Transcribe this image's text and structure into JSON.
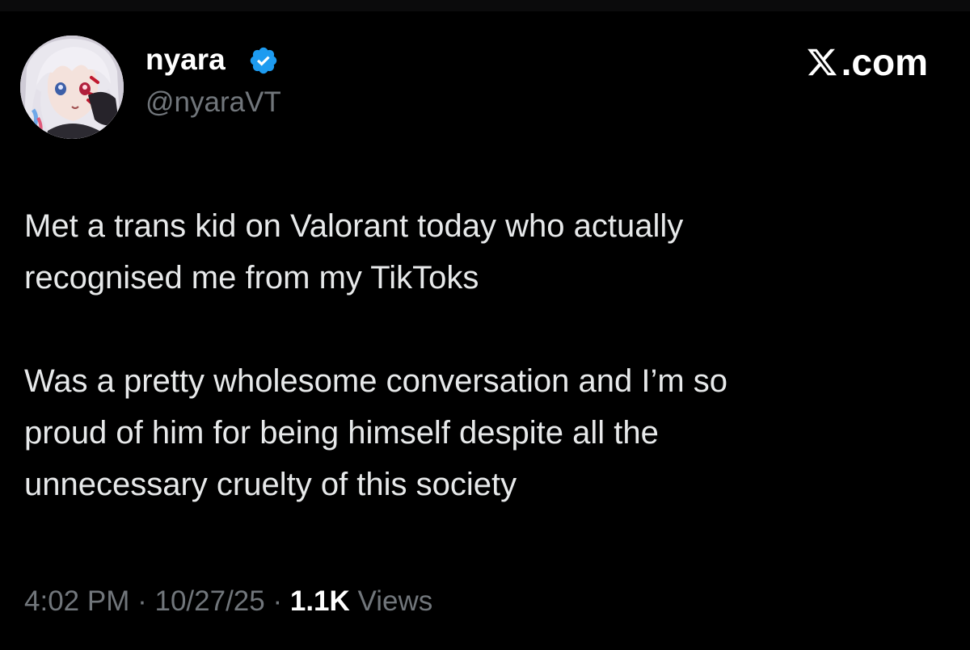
{
  "author": {
    "display_name": "nyara",
    "handle": "@nyaraVT",
    "verified": true,
    "avatar_icon": "anime-avatar"
  },
  "brand": {
    "icon": "x-logo-icon",
    "text": ".com"
  },
  "tweet": {
    "paragraphs": [
      "Met a trans kid on Valorant today who actually\nrecognised me from my TikToks",
      "Was a pretty wholesome conversation and I’m so\nproud of him for being himself despite all the\nunnecessary cruelty of this society"
    ]
  },
  "meta": {
    "time": "4:02 PM",
    "separator": "·",
    "date": "10/27/25",
    "views_count": "1.1K",
    "views_label": "Views"
  },
  "colors": {
    "background": "#000000",
    "text": "#e7e9ea",
    "secondary": "#71767b",
    "verified": "#1d9bf0"
  }
}
